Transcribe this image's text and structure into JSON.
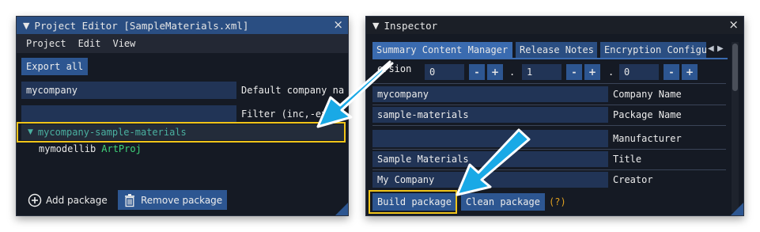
{
  "project_editor": {
    "title": "Project Editor [SampleMaterials.xml]",
    "menu": [
      "Project",
      "Edit",
      "View"
    ],
    "export_button": "Export all",
    "company_field_value": "mycompany",
    "company_field_label": "Default company name",
    "filter_field_value": "",
    "filter_field_label": "Filter (inc,-exc)",
    "tree": {
      "package_name": "mycompany-sample-materials",
      "child_name": "mymodellib",
      "child_type": "ArtProj"
    },
    "add_package_label": "Add package",
    "remove_package_label": "Remove package",
    "close_glyph": "×",
    "expand_glyph": "▼"
  },
  "inspector": {
    "title": "Inspector",
    "close_glyph": "×",
    "tabs": [
      "Summary Content Manager",
      "Release Notes",
      "Encryption Configu"
    ],
    "version_label": "ersion",
    "version_major": "0",
    "version_minor": "1",
    "version_patch": "0",
    "minus": "-",
    "plus": "+",
    "dot": ".",
    "fields": [
      {
        "value": "mycompany",
        "label": "Company Name"
      },
      {
        "value": "sample-materials",
        "label": "Package Name"
      },
      {
        "value": "",
        "label": "Manufacturer"
      },
      {
        "value": "Sample Materials",
        "label": "Title"
      },
      {
        "value": "My Company",
        "label": "Creator"
      }
    ],
    "build_button": "Build package",
    "clean_button": "Clean package",
    "help": "(?)"
  },
  "colors": {
    "highlight": "#f0c419",
    "arrow": "#19a9e6",
    "accent": "#2d5691",
    "tree_package": "#4ab0a0",
    "art_proj": "#3fd47a",
    "help": "#e0a020"
  },
  "icons": [
    "close-icon",
    "collapse-triangle-icon",
    "add-circle-icon",
    "trash-icon",
    "tab-scroll-left-icon",
    "tab-scroll-right-icon",
    "pointer-arrow-icon"
  ]
}
